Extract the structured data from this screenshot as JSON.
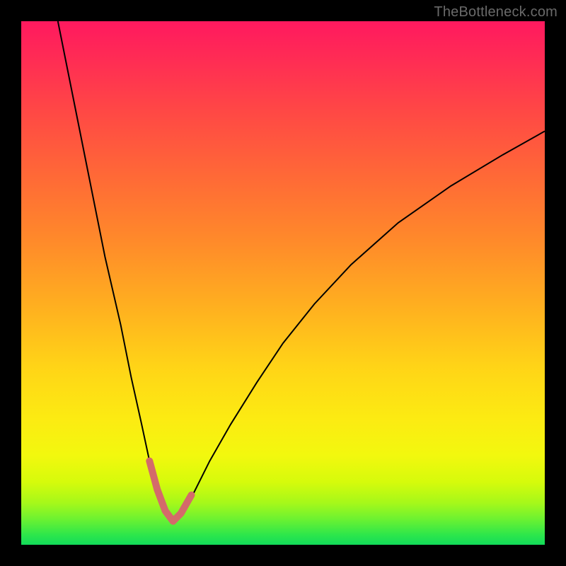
{
  "watermark": "TheBottleneck.com",
  "chart_data": {
    "type": "line",
    "title": "",
    "xlabel": "",
    "ylabel": "",
    "xlim": [
      0,
      100
    ],
    "ylim": [
      0,
      100
    ],
    "grid": false,
    "legend": false,
    "background_gradient_stops": [
      {
        "pos": 0,
        "color": "#ff195f"
      },
      {
        "pos": 18,
        "color": "#ff4a44"
      },
      {
        "pos": 42,
        "color": "#ff8a2a"
      },
      {
        "pos": 66,
        "color": "#ffd417"
      },
      {
        "pos": 83,
        "color": "#f2f80e"
      },
      {
        "pos": 95,
        "color": "#6ef230"
      },
      {
        "pos": 100,
        "color": "#12db5a"
      }
    ],
    "series": [
      {
        "name": "main-curve",
        "color": "#000000",
        "stroke_width": 2,
        "x": [
          7,
          10,
          13,
          16,
          19,
          21,
          23,
          24.5,
          26,
          27.5,
          29,
          30.5,
          33,
          36,
          40,
          45,
          50,
          56,
          63,
          72,
          82,
          92,
          100
        ],
        "values": [
          100,
          85,
          70,
          55,
          42,
          32,
          23,
          16,
          10.5,
          6.5,
          4.5,
          6,
          10,
          16,
          23,
          31,
          38.5,
          46,
          53.5,
          61.5,
          68.5,
          74.5,
          79
        ]
      },
      {
        "name": "highlight-near-minimum",
        "color": "#d46a6a",
        "stroke_width": 10,
        "linecap": "round",
        "x": [
          24.5,
          26,
          27.5,
          29,
          30.5,
          32.5
        ],
        "values": [
          16,
          10.5,
          6.5,
          4.5,
          6,
          9.5
        ]
      }
    ],
    "annotations": []
  }
}
